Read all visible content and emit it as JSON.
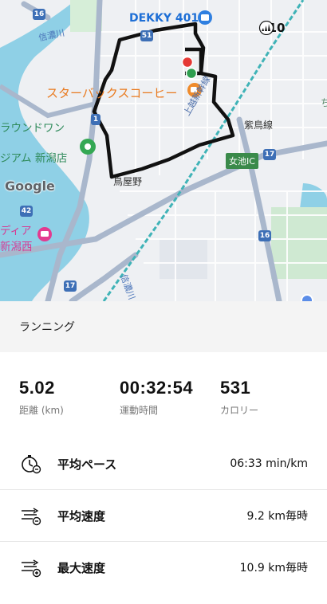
{
  "map": {
    "labels": {
      "dekky": "DEKKY 401",
      "starbucks": "スターバックスコーヒー",
      "round1_line1": "ラウンドワン",
      "round1_line2": "ジアム 新潟店",
      "karasuyano": "鳥屋野",
      "shinkansen": "上越新幹線",
      "shinano_top": "信濃川",
      "shinano_bottom": "信濃川",
      "shibitori": "紫鳥線",
      "pink_line1": "ディア",
      "pink_line2": "新潟西",
      "google": "Google",
      "ic": "女池IC",
      "edge": "ち"
    },
    "route_shields": [
      "16",
      "51",
      "1",
      "17",
      "42",
      "16",
      "17"
    ],
    "badge": {
      "icon": "adidas-icon",
      "text": "+10"
    },
    "colors": {
      "route": "#111111",
      "water": "#8fd0e6",
      "road": "#a9b7cc",
      "rail": "#3fb3b7"
    }
  },
  "activity": {
    "title": "ランニング"
  },
  "stats": [
    {
      "value": "5.02",
      "label": "距離 (km)"
    },
    {
      "value": "00:32:54",
      "label": "運動時間"
    },
    {
      "value": "531",
      "label": "カロリー"
    }
  ],
  "metrics": [
    {
      "icon": "stopwatch-icon",
      "label": "平均ペース",
      "value": "06:33 min/km"
    },
    {
      "icon": "speed-icon",
      "label": "平均速度",
      "value": "9.2 km毎時"
    },
    {
      "icon": "max-speed-icon",
      "label": "最大速度",
      "value": "10.9 km毎時"
    }
  ]
}
